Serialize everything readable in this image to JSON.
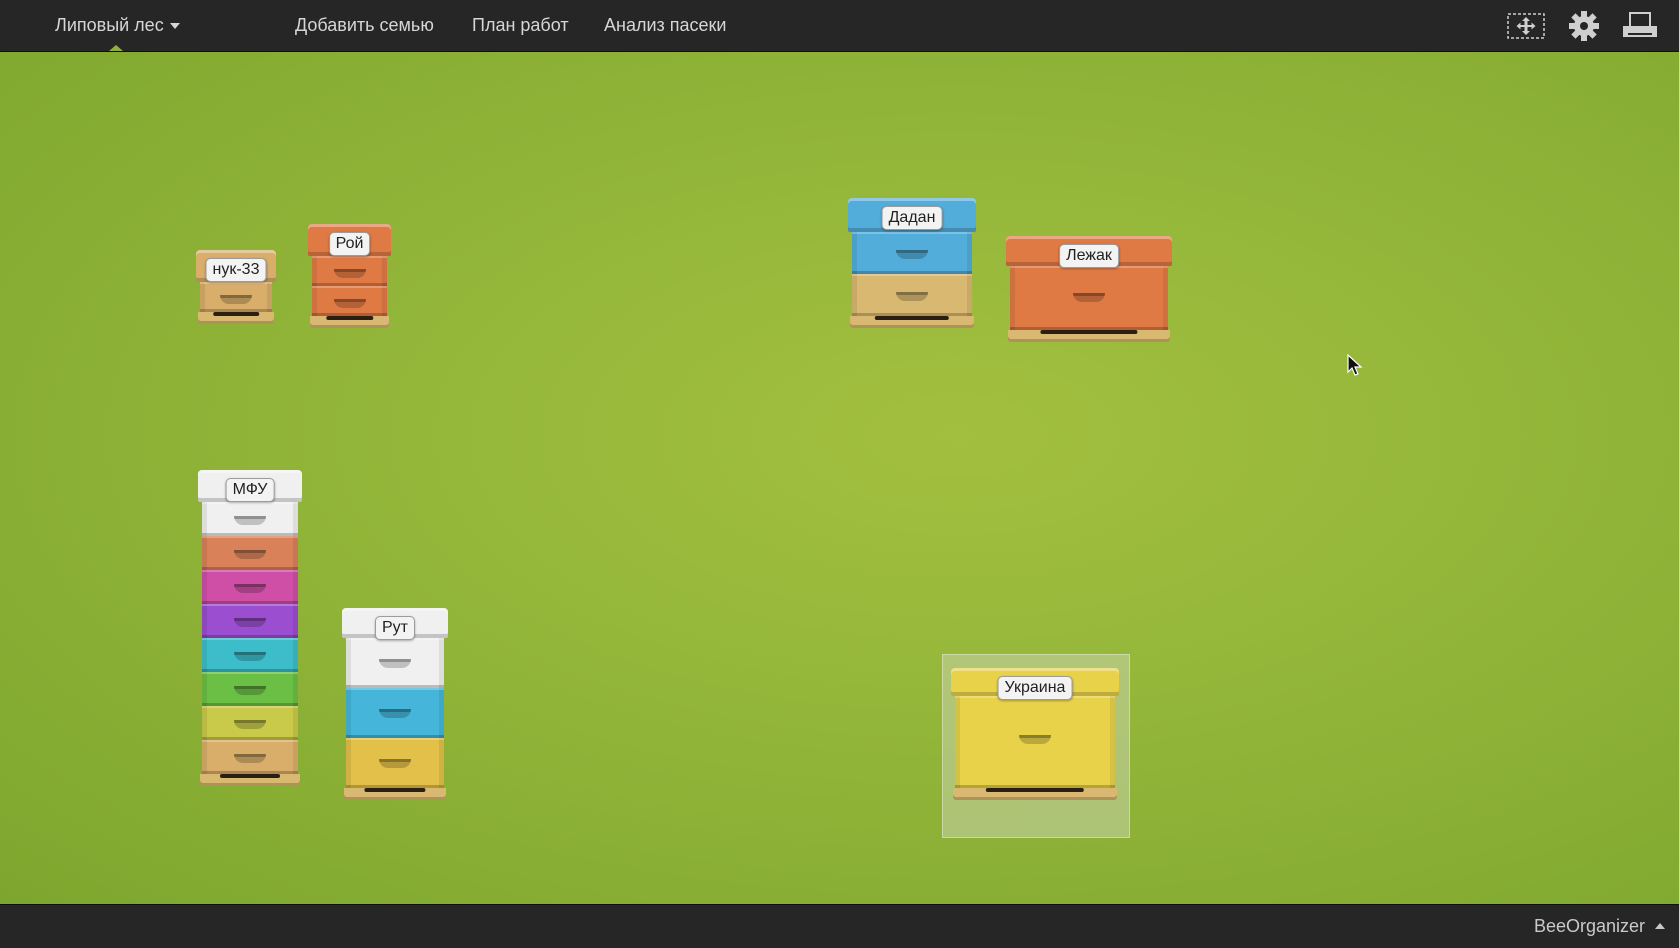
{
  "topbar": {
    "apiary": "Липовый лес",
    "nav": [
      "Добавить семью",
      "План работ",
      "Анализ пасеки"
    ],
    "icons": [
      "select-move-icon",
      "gear-icon",
      "printer-icon"
    ]
  },
  "hives": [
    {
      "label": "нук-33",
      "colors": {
        "roof": "#d9ae6a",
        "boxes": [
          "#d9ae6a"
        ]
      }
    },
    {
      "label": "Рой",
      "colors": {
        "roof": "#e07a45",
        "boxes": [
          "#e07a45",
          "#e07a45"
        ]
      }
    },
    {
      "label": "Дадан",
      "colors": {
        "roof": "#52addb",
        "boxes": [
          "#52addb",
          "#d9b871"
        ]
      }
    },
    {
      "label": "Лежак",
      "colors": {
        "roof": "#e07a45",
        "boxes": [
          "#e07a45"
        ]
      }
    },
    {
      "label": "МФУ",
      "colors": {
        "roof": "#f0f0f0",
        "boxes": [
          "#f0f0f0",
          "#d9825a",
          "#cf4fa6",
          "#9b4fd0",
          "#3dbdc9",
          "#6cbf45",
          "#c9c94a",
          "#d9ae6a"
        ]
      }
    },
    {
      "label": "Рут",
      "colors": {
        "roof": "#f0f0f0",
        "boxes": [
          "#f0f0f0",
          "#45b6d9",
          "#e3c04a"
        ]
      }
    },
    {
      "label": "Украина",
      "colors": {
        "roof": "#e8d24a",
        "boxes": [
          "#e8d24a"
        ]
      }
    }
  ],
  "selected_hive": "Украина",
  "footer": {
    "brand": "BeeOrganizer"
  },
  "colors": {
    "field": "#94b73a",
    "bar": "#262626"
  }
}
